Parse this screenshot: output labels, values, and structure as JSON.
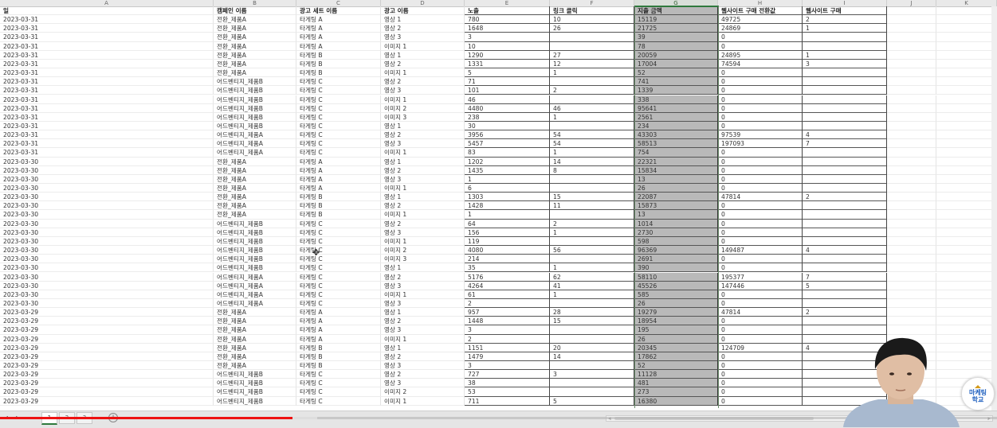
{
  "columns": [
    "A",
    "B",
    "C",
    "D",
    "E",
    "F",
    "G",
    "H",
    "I",
    "J",
    "K"
  ],
  "selected_column": "G",
  "headers": [
    "일",
    "캠페인 이름",
    "광고 세트 이름",
    "광고 이름",
    "노출",
    "링크 클릭",
    "지출 금액",
    "웹사이트 구매 전환값",
    "웹사이트 구매"
  ],
  "rows": [
    [
      "2023-03-31",
      "전환_제품A",
      "타게팅 A",
      "영상 1",
      "780",
      "10",
      "15119",
      "49725",
      "2"
    ],
    [
      "2023-03-31",
      "전환_제품A",
      "타게팅 A",
      "영상 2",
      "1648",
      "26",
      "21725",
      "24869",
      "1"
    ],
    [
      "2023-03-31",
      "전환_제품A",
      "타게팅 A",
      "영상 3",
      "3",
      "",
      "39",
      "0",
      ""
    ],
    [
      "2023-03-31",
      "전환_제품A",
      "타게팅 A",
      "이미지 1",
      "10",
      "",
      "78",
      "0",
      ""
    ],
    [
      "2023-03-31",
      "전환_제품A",
      "타게팅 B",
      "영상 1",
      "1290",
      "27",
      "20059",
      "24895",
      "1"
    ],
    [
      "2023-03-31",
      "전환_제품A",
      "타게팅 B",
      "영상 2",
      "1331",
      "12",
      "17004",
      "74594",
      "3"
    ],
    [
      "2023-03-31",
      "전환_제품A",
      "타게팅 B",
      "이미지 1",
      "5",
      "1",
      "52",
      "0",
      ""
    ],
    [
      "2023-03-31",
      "어드벤티지_제품B",
      "타게팅 C",
      "영상 2",
      "71",
      "",
      "741",
      "0",
      ""
    ],
    [
      "2023-03-31",
      "어드벤티지_제품B",
      "타게팅 C",
      "영상 3",
      "101",
      "2",
      "1339",
      "0",
      ""
    ],
    [
      "2023-03-31",
      "어드벤티지_제품B",
      "타게팅 C",
      "이미지 1",
      "46",
      "",
      "338",
      "0",
      ""
    ],
    [
      "2023-03-31",
      "어드벤티지_제품B",
      "타게팅 C",
      "이미지 2",
      "4480",
      "46",
      "95641",
      "0",
      ""
    ],
    [
      "2023-03-31",
      "어드벤티지_제품B",
      "타게팅 C",
      "이미지 3",
      "238",
      "1",
      "2561",
      "0",
      ""
    ],
    [
      "2023-03-31",
      "어드벤티지_제품B",
      "타게팅 C",
      "영상 1",
      "30",
      "",
      "234",
      "0",
      ""
    ],
    [
      "2023-03-31",
      "어드벤티지_제품A",
      "타게팅 C",
      "영상 2",
      "3956",
      "54",
      "43303",
      "97539",
      "4"
    ],
    [
      "2023-03-31",
      "어드벤티지_제품A",
      "타게팅 C",
      "영상 3",
      "5457",
      "54",
      "58513",
      "197093",
      "7"
    ],
    [
      "2023-03-31",
      "어드벤티지_제품A",
      "타게팅 C",
      "이미지 1",
      "83",
      "1",
      "754",
      "0",
      ""
    ],
    [
      "2023-03-30",
      "전환_제품A",
      "타게팅 A",
      "영상 1",
      "1202",
      "14",
      "22321",
      "0",
      ""
    ],
    [
      "2023-03-30",
      "전환_제품A",
      "타게팅 A",
      "영상 2",
      "1435",
      "8",
      "15834",
      "0",
      ""
    ],
    [
      "2023-03-30",
      "전환_제품A",
      "타게팅 A",
      "영상 3",
      "1",
      "",
      "13",
      "0",
      ""
    ],
    [
      "2023-03-30",
      "전환_제품A",
      "타게팅 A",
      "이미지 1",
      "6",
      "",
      "26",
      "0",
      ""
    ],
    [
      "2023-03-30",
      "전환_제품A",
      "타게팅 B",
      "영상 1",
      "1303",
      "15",
      "22087",
      "47814",
      "2"
    ],
    [
      "2023-03-30",
      "전환_제품A",
      "타게팅 B",
      "영상 2",
      "1428",
      "11",
      "15873",
      "0",
      ""
    ],
    [
      "2023-03-30",
      "전환_제품A",
      "타게팅 B",
      "이미지 1",
      "1",
      "",
      "13",
      "0",
      ""
    ],
    [
      "2023-03-30",
      "어드벤티지_제품B",
      "타게팅 C",
      "영상 2",
      "64",
      "2",
      "1014",
      "0",
      ""
    ],
    [
      "2023-03-30",
      "어드벤티지_제품B",
      "타게팅 C",
      "영상 3",
      "156",
      "1",
      "2730",
      "0",
      ""
    ],
    [
      "2023-03-30",
      "어드벤티지_제품B",
      "타게팅 C",
      "이미지 1",
      "119",
      "",
      "598",
      "0",
      ""
    ],
    [
      "2023-03-30",
      "어드벤티지_제품B",
      "타게팅 C",
      "이미지 2",
      "4080",
      "56",
      "96369",
      "149487",
      "4"
    ],
    [
      "2023-03-30",
      "어드벤티지_제품B",
      "타게팅 C",
      "이미지 3",
      "214",
      "",
      "2691",
      "0",
      ""
    ],
    [
      "2023-03-30",
      "어드벤티지_제품B",
      "타게팅 C",
      "영상 1",
      "35",
      "1",
      "390",
      "0",
      ""
    ],
    [
      "2023-03-30",
      "어드벤티지_제품A",
      "타게팅 C",
      "영상 2",
      "5176",
      "62",
      "58110",
      "195377",
      "7"
    ],
    [
      "2023-03-30",
      "어드벤티지_제품A",
      "타게팅 C",
      "영상 3",
      "4264",
      "41",
      "45526",
      "147446",
      "5"
    ],
    [
      "2023-03-30",
      "어드벤티지_제품A",
      "타게팅 C",
      "이미지 1",
      "61",
      "1",
      "585",
      "0",
      ""
    ],
    [
      "2023-03-30",
      "어드벤티지_제품A",
      "타게팅 C",
      "영상 3",
      "2",
      "",
      "26",
      "0",
      ""
    ],
    [
      "2023-03-29",
      "전환_제품A",
      "타게팅 A",
      "영상 1",
      "957",
      "28",
      "19279",
      "47814",
      "2"
    ],
    [
      "2023-03-29",
      "전환_제품A",
      "타게팅 A",
      "영상 2",
      "1448",
      "15",
      "18954",
      "0",
      ""
    ],
    [
      "2023-03-29",
      "전환_제품A",
      "타게팅 A",
      "영상 3",
      "3",
      "",
      "195",
      "0",
      ""
    ],
    [
      "2023-03-29",
      "전환_제품A",
      "타게팅 A",
      "이미지 1",
      "2",
      "",
      "26",
      "0",
      ""
    ],
    [
      "2023-03-29",
      "전환_제품A",
      "타게팅 B",
      "영상 1",
      "1151",
      "20",
      "20345",
      "124709",
      "4"
    ],
    [
      "2023-03-29",
      "전환_제품A",
      "타게팅 B",
      "영상 2",
      "1479",
      "14",
      "17862",
      "0",
      ""
    ],
    [
      "2023-03-29",
      "전환_제품A",
      "타게팅 B",
      "영상 3",
      "3",
      "",
      "52",
      "0",
      ""
    ],
    [
      "2023-03-29",
      "어드벤티지_제품B",
      "타게팅 C",
      "영상 2",
      "727",
      "3",
      "11128",
      "0",
      ""
    ],
    [
      "2023-03-29",
      "어드벤티지_제품B",
      "타게팅 C",
      "영상 3",
      "38",
      "",
      "481",
      "0",
      ""
    ],
    [
      "2023-03-29",
      "어드벤티지_제품B",
      "타게팅 C",
      "이미지 2",
      "53",
      "",
      "273",
      "0",
      ""
    ],
    [
      "2023-03-29",
      "어드벤티지_제품B",
      "타게팅 C",
      "이미지 1",
      "711",
      "5",
      "16380",
      "0",
      ""
    ]
  ],
  "sheet_tabs": [
    "1",
    "2",
    "3"
  ],
  "add_sheet_label": "+",
  "video_progress": 0.293,
  "video_buffered": 0.318,
  "logo": {
    "line1": "마케팅",
    "line2": "학교",
    "accent": "#1e5fbf"
  },
  "colors": {
    "selected_column_fill": "#b9b9b9",
    "selection_border": "#2f7a3d",
    "progress": "#ee1111"
  }
}
